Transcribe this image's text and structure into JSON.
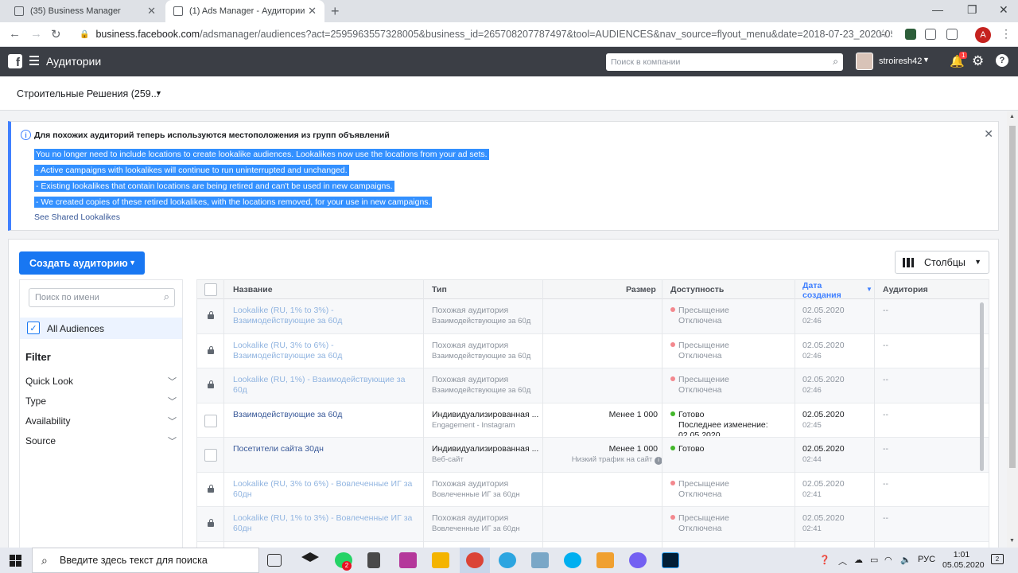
{
  "browser": {
    "tabs": [
      {
        "title": "(35) Business Manager",
        "active": false
      },
      {
        "title": "(1) Ads Manager - Аудитории",
        "active": true
      }
    ],
    "url_host": "business.facebook.com",
    "url_path": "/adsmanager/audiences?act=2595963557328005&business_id=265708207787497&tool=AUDIENCES&nav_source=flyout_menu&date=2018-07-23_2020-05-03%2C...",
    "profile_initial": "A"
  },
  "topbar": {
    "title": "Аудитории",
    "search_placeholder": "Поиск в компании",
    "username": "stroiresh42",
    "notifications": "1"
  },
  "account": {
    "name": "Строительные Решения (259..."
  },
  "notice": {
    "title": "Для похожих аудиторий теперь используются местоположения из групп объявлений",
    "lines": [
      "You no longer need to include locations to create lookalike audiences. Lookalikes now use the locations from your ad sets.",
      "- Active campaigns with lookalikes will continue to run uninterrupted and unchanged.",
      "- Existing lookalikes that contain locations are being retired and can't be used in new campaigns.",
      "- We created copies of these retired lookalikes, with the locations removed, for your use in new campaigns."
    ],
    "link": "See Shared Lookalikes"
  },
  "toolbar": {
    "create_label": "Создать аудиторию",
    "columns_label": "Столбцы"
  },
  "filters": {
    "search_placeholder": "Поиск по имени",
    "all_label": "All Audiences",
    "heading": "Filter",
    "facets": [
      "Quick Look",
      "Type",
      "Availability",
      "Source"
    ]
  },
  "table": {
    "headers": {
      "name": "Название",
      "type": "Тип",
      "size": "Размер",
      "availability": "Доступность",
      "date": "Дата создания",
      "audience": "Аудитория"
    },
    "rows": [
      {
        "locked": true,
        "name": "Lookalike (RU, 1% to 3%) - Взаимодействующие за 60д",
        "type": "Похожая аудитория",
        "subtype": "Взаимодействующие за 60д",
        "size": "",
        "size_note": "",
        "status": "Пресыщение",
        "status_note": "Отключена",
        "status_color": "#f3888e",
        "date": "02.05.2020",
        "time": "02:46",
        "audience": "--"
      },
      {
        "locked": true,
        "name": "Lookalike (RU, 3% to 6%) - Взаимодействующие за 60д",
        "type": "Похожая аудитория",
        "subtype": "Взаимодействующие за 60д",
        "size": "",
        "size_note": "",
        "status": "Пресыщение",
        "status_note": "Отключена",
        "status_color": "#f3888e",
        "date": "02.05.2020",
        "time": "02:46",
        "audience": "--"
      },
      {
        "locked": true,
        "name": "Lookalike (RU, 1%) - Взаимодействующие за 60д",
        "type": "Похожая аудитория",
        "subtype": "Взаимодействующие за 60д",
        "size": "",
        "size_note": "",
        "status": "Пресыщение",
        "status_note": "Отключена",
        "status_color": "#f3888e",
        "date": "02.05.2020",
        "time": "02:46",
        "audience": "--"
      },
      {
        "locked": false,
        "name": "Взаимодействующие за 60д",
        "type": "Индивидуализированная ...",
        "subtype": "Engagement - Instagram",
        "size": "Менее 1 000",
        "size_note": "",
        "status": "Готово",
        "status_note": "Последнее изменение: 02.05.2020",
        "status_color": "#42b72a",
        "date": "02.05.2020",
        "time": "02:45",
        "audience": "--"
      },
      {
        "locked": false,
        "name": "Посетители сайта 30дн",
        "type": "Индивидуализированная ...",
        "subtype": "Веб-сайт",
        "size": "Менее 1 000",
        "size_note": "Низкий трафик на сайт",
        "status": "Готово",
        "status_note": "",
        "status_color": "#42b72a",
        "date": "02.05.2020",
        "time": "02:44",
        "audience": "--"
      },
      {
        "locked": true,
        "name": "Lookalike (RU, 3% to 6%) - Вовлеченные ИГ за 60дн",
        "type": "Похожая аудитория",
        "subtype": "Вовлеченные ИГ за 60дн",
        "size": "",
        "size_note": "",
        "status": "Пресыщение",
        "status_note": "Отключена",
        "status_color": "#f3888e",
        "date": "02.05.2020",
        "time": "02:41",
        "audience": "--"
      },
      {
        "locked": true,
        "name": "Lookalike (RU, 1% to 3%) - Вовлеченные ИГ за 60дн",
        "type": "Похожая аудитория",
        "subtype": "Вовлеченные ИГ за 60дн",
        "size": "",
        "size_note": "",
        "status": "Пресыщение",
        "status_note": "Отключена",
        "status_color": "#f3888e",
        "date": "02.05.2020",
        "time": "02:41",
        "audience": "--"
      }
    ]
  },
  "taskbar": {
    "search_placeholder": "Введите здесь текст для поиска",
    "lang": "РУС",
    "time": "1:01",
    "date": "05.05.2020",
    "notif_count": "2",
    "whatsapp_badge": "2"
  }
}
